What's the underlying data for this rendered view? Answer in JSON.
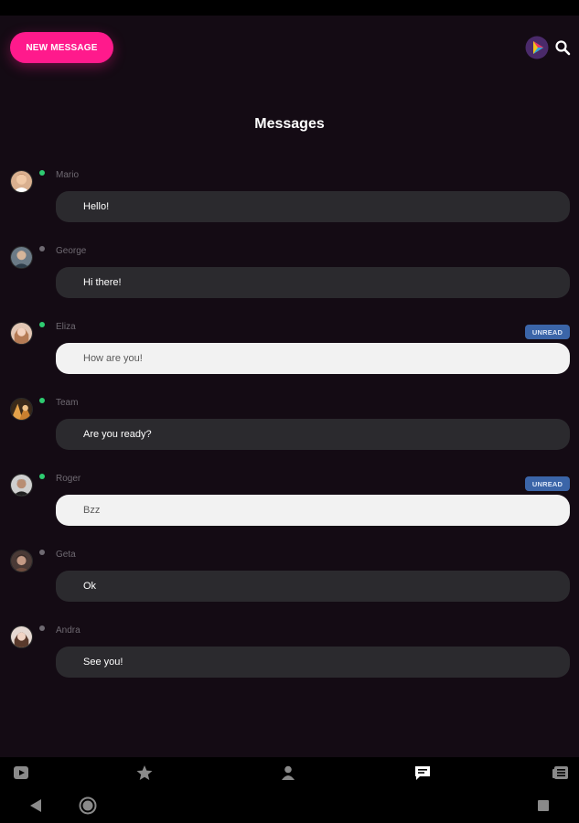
{
  "header": {
    "new_message_label": "NEW MESSAGE",
    "brand_logo": "play-logo-icon",
    "search": "search-icon"
  },
  "page": {
    "title": "Messages"
  },
  "conversations": [
    {
      "sender": "Mario",
      "message": "Hello!",
      "online": true,
      "unread": false,
      "badge": ""
    },
    {
      "sender": "George",
      "message": "Hi there!",
      "online": false,
      "unread": false,
      "badge": ""
    },
    {
      "sender": "Eliza",
      "message": "How are you!",
      "online": true,
      "unread": true,
      "badge": "UNREAD"
    },
    {
      "sender": "Team",
      "message": "Are you ready?",
      "online": true,
      "unread": false,
      "badge": ""
    },
    {
      "sender": "Roger",
      "message": "Bzz",
      "online": true,
      "unread": true,
      "badge": "UNREAD"
    },
    {
      "sender": "Geta",
      "message": "Ok",
      "online": false,
      "unread": false,
      "badge": ""
    },
    {
      "sender": "Andra",
      "message": "See you!",
      "online": false,
      "unread": false,
      "badge": ""
    }
  ],
  "bottom_nav": [
    "video-icon",
    "star-icon",
    "profile-icon",
    "messages-icon",
    "news-icon"
  ],
  "system_nav": [
    "back-icon",
    "home-icon",
    "recents-icon"
  ],
  "colors": {
    "accent": "#ff1a8c",
    "online": "#2ecc71",
    "offline": "#6f6a72",
    "unread_badge": "#3b65a8"
  }
}
